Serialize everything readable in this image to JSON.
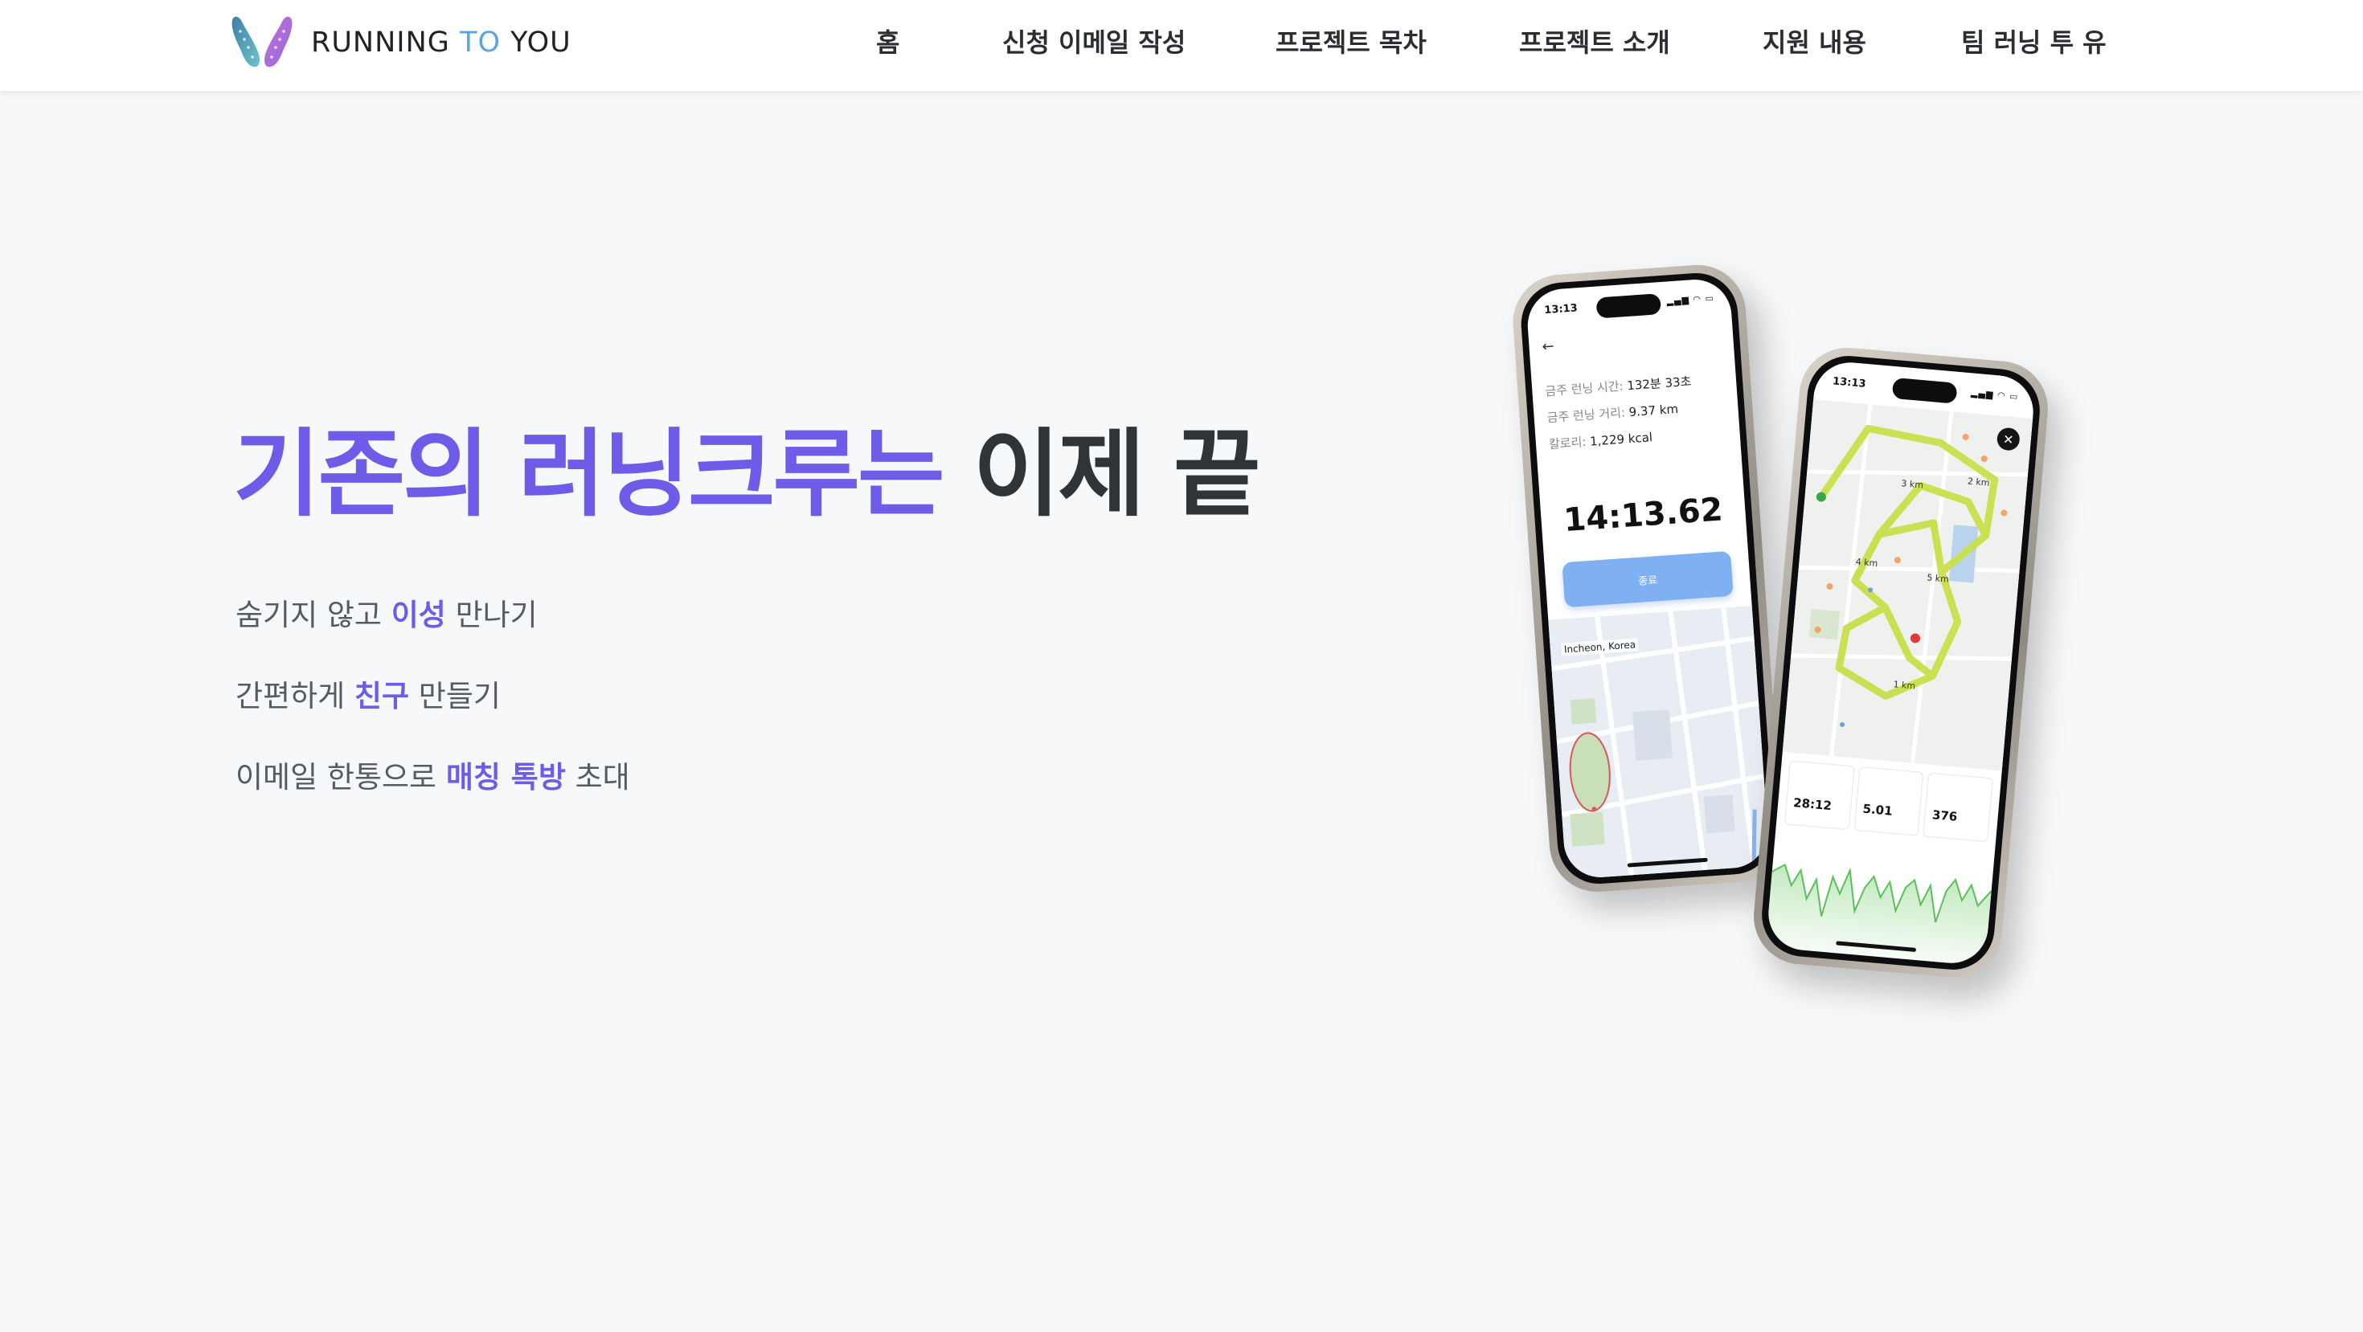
{
  "brand": {
    "name_part1": "RUNNING ",
    "name_part2": "TO",
    "name_part3": " YOU"
  },
  "nav": {
    "items": [
      {
        "label": "홈"
      },
      {
        "label": "신청 이메일 작성"
      },
      {
        "label": "프로젝트 목차"
      },
      {
        "label": "프로젝트 소개"
      },
      {
        "label": "지원 내용"
      },
      {
        "label": "팀 러닝 투 유"
      }
    ]
  },
  "hero": {
    "title_accent": "기존의 러닝크루는",
    "title_rest": "이제 끝",
    "taglines": [
      {
        "pre": "숨기지 않고 ",
        "highlight": "이성",
        "post": " 만나기"
      },
      {
        "pre": "간편하게 ",
        "highlight": "친구",
        "post": " 만들기"
      },
      {
        "pre": "이메일 한통으로 ",
        "highlight": "매칭 톡방",
        "post": " 초대"
      }
    ]
  },
  "phone1": {
    "time": "13:13",
    "stat_time_label": "금주 런닝 시간: ",
    "stat_time_value": "132분 33초",
    "stat_distance_label": "금주 런닝 거리: ",
    "stat_distance_value": "9.37 km",
    "stat_calorie_label": "칼로리: ",
    "stat_calorie_value": "1,229 kcal",
    "timer": "14:13.62",
    "end_button": "종료",
    "map_location": "Incheon, Korea"
  },
  "phone2": {
    "time": "13:13",
    "route_labels": [
      "3 km",
      "2 km",
      "4 km",
      "5 km",
      "1 km"
    ],
    "metric_values": [
      "28:12",
      "5.01",
      "376"
    ]
  },
  "colors": {
    "accent": "#6c5ce7",
    "logo_to": "#5aa5e0",
    "background": "#f7f8fa"
  },
  "icons": {
    "logo": "running-shoes-icon",
    "close": "close-icon",
    "back": "back-arrow-icon"
  }
}
